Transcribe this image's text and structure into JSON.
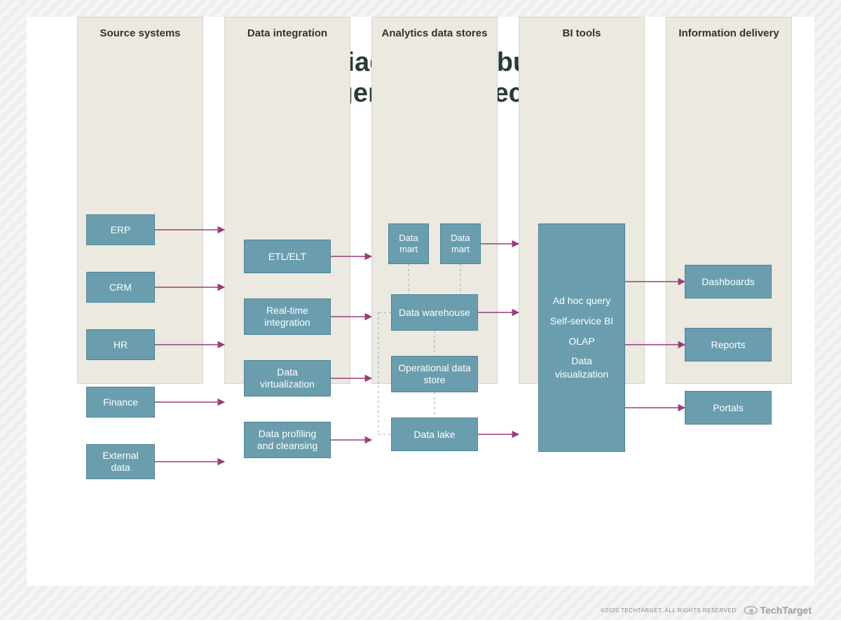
{
  "title_line1": "Sample diagram of a business",
  "title_line2": "intelligence architecture",
  "columns": {
    "c1": {
      "title": "Source systems",
      "boxes": [
        "ERP",
        "CRM",
        "HR",
        "Finance",
        "External data"
      ]
    },
    "c2": {
      "title": "Data integration",
      "boxes": [
        "ETL/ELT",
        "Real-time integration",
        "Data virtualization",
        "Data profiling and cleansing"
      ]
    },
    "c3": {
      "title": "Analytics data stores",
      "marts": [
        "Data mart",
        "Data mart"
      ],
      "boxes": [
        "Data warehouse",
        "Operational data store",
        "Data lake"
      ]
    },
    "c4": {
      "title": "BI tools",
      "tools": [
        "Ad hoc query",
        "Self-service BI",
        "OLAP",
        "Data visualization"
      ]
    },
    "c5": {
      "title": "Information delivery",
      "boxes": [
        "Dashboards",
        "Reports",
        "Portals"
      ]
    }
  },
  "footer": {
    "copyright": "©2020 TECHTARGET. ALL RIGHTS RESERVED",
    "brand": "TechTarget"
  },
  "arrows": [
    {
      "from": "c1b0",
      "to": "c2col"
    },
    {
      "from": "c1b1",
      "to": "c2col"
    },
    {
      "from": "c1b2",
      "to": "c2col"
    },
    {
      "from": "c1b3",
      "to": "c2col"
    },
    {
      "from": "c1b4",
      "to": "c2col"
    },
    {
      "from": "c2b0",
      "to": "c3col"
    },
    {
      "from": "c2b1",
      "to": "c3col"
    },
    {
      "from": "c2b2",
      "to": "c3col"
    },
    {
      "from": "c2b3",
      "to": "c3col"
    },
    {
      "from": "c3m1",
      "to": "c4col"
    },
    {
      "from": "c3w",
      "to": "c4col"
    },
    {
      "from": "c3l",
      "to": "c4col"
    },
    {
      "from": "c4big-top",
      "to": "c5b0"
    },
    {
      "from": "c4big-mid",
      "to": "c5b1"
    },
    {
      "from": "c4big-bot",
      "to": "c5b2"
    }
  ],
  "dotted_links": [
    [
      "c3m0",
      "c3w"
    ],
    [
      "c3m1",
      "c3w"
    ],
    [
      "c3w",
      "c3o"
    ],
    [
      "c3o",
      "c3l"
    ]
  ],
  "colors": {
    "box": "#6a9eae",
    "col": "#ebe9e0",
    "arrow": "#9a3d78"
  }
}
